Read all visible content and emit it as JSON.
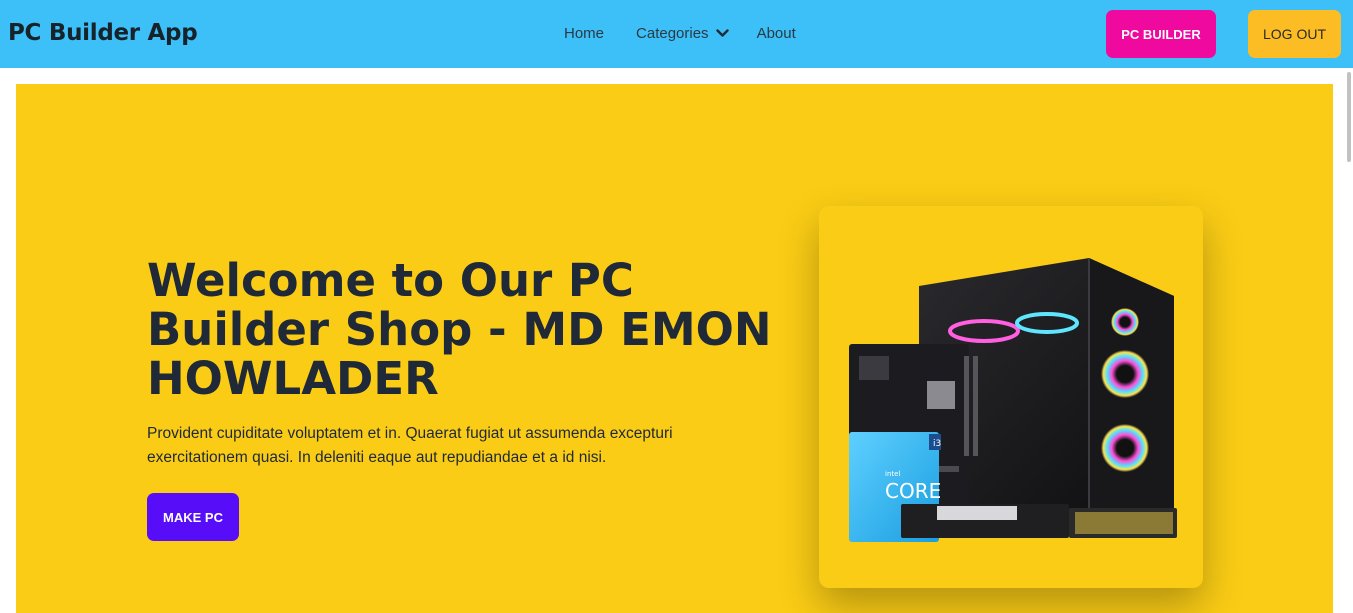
{
  "navbar": {
    "brand": "PC Builder App",
    "links": {
      "home": "Home",
      "categories": "Categories",
      "about": "About"
    },
    "pc_builder_label": "PC BUILDER",
    "logout_label": "LOG OUT"
  },
  "hero": {
    "title": "Welcome to Our PC Builder Shop - MD EMON HOWLADER",
    "text": "Provident cupiditate voluptatem et in. Quaerat fugiat ut assumenda excepturi exercitationem quasi. In deleniti eaque aut repudiandae et a id nisi.",
    "cta_label": "MAKE PC",
    "image_icon": "pc-build-image",
    "image_labels": {
      "cpu_brand": "intel",
      "cpu_name": "CORE",
      "cpu_tier": "i3"
    }
  },
  "colors": {
    "navbar_bg": "#3dbff8",
    "hero_bg": "#facc15",
    "pc_builder_btn": "#f0099f",
    "logout_btn": "#fbbd23",
    "make_pc_btn": "#570df8",
    "text_dark": "#1f2937"
  }
}
